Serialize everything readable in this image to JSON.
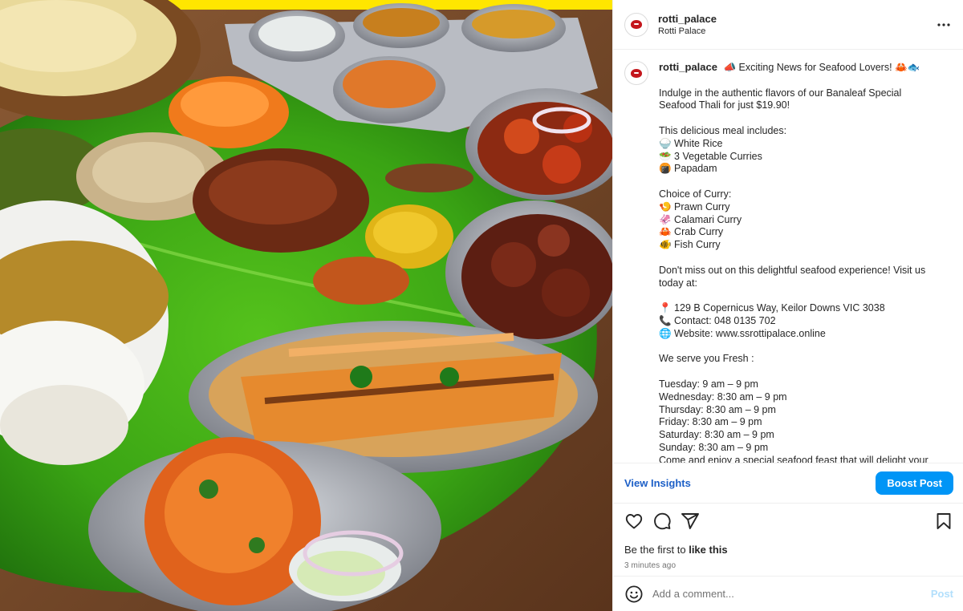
{
  "header": {
    "username": "rotti_palace",
    "subtitle": "Rotti Palace",
    "more_icon": "more-horizontal-icon"
  },
  "photo": {
    "alt": "Banana leaf seafood thali with rice, curries, papadam, fried fish and crab"
  },
  "caption": {
    "username": "rotti_palace",
    "first_line": "📣 Exciting News for Seafood Lovers! 🦀🐟",
    "lines": [
      "",
      "Indulge in the authentic flavors of our Banaleaf Special",
      "Seafood Thali for just $19.90!",
      "",
      "This delicious meal includes:",
      "🍚 White Rice",
      "🥗 3 Vegetable Curries",
      "🍘 Papadam",
      "",
      "Choice of Curry:",
      "🍤 Prawn Curry",
      "🦑 Calamari Curry",
      "🦀 Crab Curry",
      "🐠 Fish Curry",
      "",
      "Don't miss out on this delightful seafood experience! Visit us",
      "today at:",
      "",
      "📍 129 B Copernicus Way, Keilor Downs VIC 3038",
      "📞 Contact: 048 0135 702",
      "🌐 Website: www.ssrottipalace.online",
      "",
      "We serve you Fresh :",
      "",
      "Tuesday: 9 am – 9 pm",
      "Wednesday: 8:30 am – 9 pm",
      "Thursday: 8:30 am – 9 pm",
      "Friday: 8:30 am – 9 pm",
      "Saturday: 8:30 am – 9 pm",
      "Sunday: 8:30 am – 9 pm",
      "Come and enjoy a special seafood feast that will delight your"
    ]
  },
  "insights": {
    "view_label": "View Insights",
    "boost_label": "Boost Post"
  },
  "actions": {
    "like_icon": "heart-icon",
    "comment_icon": "comment-icon",
    "share_icon": "share-icon",
    "save_icon": "bookmark-icon",
    "likes_prefix": "Be the first to ",
    "likes_action": "like this",
    "timestamp": "3 minutes ago"
  },
  "comment": {
    "placeholder": "Add a comment...",
    "post_label": "Post",
    "emoji_icon": "emoji-icon"
  },
  "colors": {
    "accent": "#0095f6",
    "link": "#1c5fc7",
    "border": "#efefef",
    "post_disabled": "#b2dffc"
  }
}
